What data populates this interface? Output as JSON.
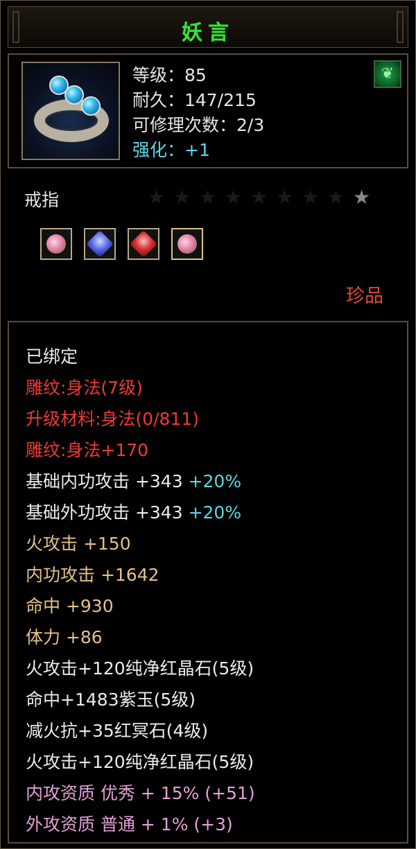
{
  "item": {
    "name": "妖言",
    "level": "等级：85",
    "durability": "耐久：147/215",
    "repairs": "可修理次数：2/3",
    "enhance": "强化：+1",
    "type": "戒指",
    "rarity": "珍品",
    "icon": "ring-icon",
    "badge_icon": "leaf-icon",
    "stars_total": 9,
    "stars_lit": 1,
    "sockets": [
      "pink-gem-icon",
      "blue-gem-icon",
      "red-gem-icon",
      "pink-gem-icon"
    ]
  },
  "stats": [
    {
      "text": "已绑定",
      "color": "white"
    },
    {
      "text": "雕纹:身法(7级)",
      "color": "red"
    },
    {
      "text": "升级材料:身法(0/811)",
      "color": "red"
    },
    {
      "text": "雕纹:身法+170",
      "color": "red"
    },
    {
      "text": "基础内功攻击 +343",
      "suffix": "+20%",
      "color": "white"
    },
    {
      "text": "基础外功攻击 +343",
      "suffix": "+20%",
      "color": "white"
    },
    {
      "text": "火攻击 +150",
      "color": "tan"
    },
    {
      "text": "内功攻击 +1642",
      "color": "tan"
    },
    {
      "text": "命中 +930",
      "color": "tan"
    },
    {
      "text": "体力 +86",
      "color": "tan"
    },
    {
      "text": "火攻击+120纯净红晶石(5级)",
      "color": "white"
    },
    {
      "text": "命中+1483紫玉(5级)",
      "color": "white"
    },
    {
      "text": "减火抗+35红冥石(4级)",
      "color": "white"
    },
    {
      "text": "火攻击+120纯净红晶石(5级)",
      "color": "white"
    },
    {
      "text": "内攻资质 优秀 + 15% (+51)",
      "color": "pink"
    },
    {
      "text": "外攻资质 普通 + 1% (+3)",
      "color": "pink"
    }
  ],
  "colors": {
    "title": "#39e33a",
    "red": "#ec3a34",
    "tan": "#e6c08a",
    "pink": "#e4a0d8",
    "cyan": "#58d8e6",
    "border": "#5c4c38"
  }
}
